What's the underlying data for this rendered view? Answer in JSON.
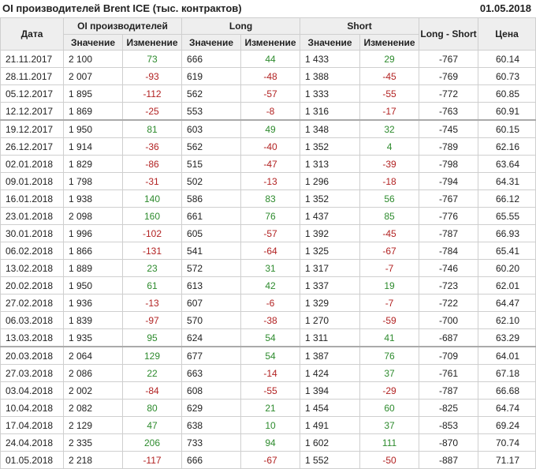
{
  "header": {
    "title": "OI производителей Brent ICE (тыс. контрактов)",
    "date": "01.05.2018"
  },
  "columns": {
    "date": "Дата",
    "oi_group": "OI производителей",
    "long_group": "Long",
    "short_group": "Short",
    "long_short": "Long - Short",
    "price": "Цена",
    "value": "Значение",
    "change": "Изменение"
  },
  "rows": [
    {
      "date": "21.11.2017",
      "oi": "2 100",
      "oi_chg": "73",
      "long": "666",
      "long_chg": "44",
      "short": "1 433",
      "short_chg": "29",
      "ls": "-767",
      "price": "60.14"
    },
    {
      "date": "28.11.2017",
      "oi": "2 007",
      "oi_chg": "-93",
      "long": "619",
      "long_chg": "-48",
      "short": "1 388",
      "short_chg": "-45",
      "ls": "-769",
      "price": "60.73"
    },
    {
      "date": "05.12.2017",
      "oi": "1 895",
      "oi_chg": "-112",
      "long": "562",
      "long_chg": "-57",
      "short": "1 333",
      "short_chg": "-55",
      "ls": "-772",
      "price": "60.85"
    },
    {
      "date": "12.12.2017",
      "oi": "1 869",
      "oi_chg": "-25",
      "long": "553",
      "long_chg": "-8",
      "short": "1 316",
      "short_chg": "-17",
      "ls": "-763",
      "price": "60.91"
    },
    {
      "date": "19.12.2017",
      "oi": "1 950",
      "oi_chg": "81",
      "long": "603",
      "long_chg": "49",
      "short": "1 348",
      "short_chg": "32",
      "ls": "-745",
      "price": "60.15"
    },
    {
      "date": "26.12.2017",
      "oi": "1 914",
      "oi_chg": "-36",
      "long": "562",
      "long_chg": "-40",
      "short": "1 352",
      "short_chg": "4",
      "ls": "-789",
      "price": "62.16"
    },
    {
      "date": "02.01.2018",
      "oi": "1 829",
      "oi_chg": "-86",
      "long": "515",
      "long_chg": "-47",
      "short": "1 313",
      "short_chg": "-39",
      "ls": "-798",
      "price": "63.64"
    },
    {
      "date": "09.01.2018",
      "oi": "1 798",
      "oi_chg": "-31",
      "long": "502",
      "long_chg": "-13",
      "short": "1 296",
      "short_chg": "-18",
      "ls": "-794",
      "price": "64.31"
    },
    {
      "date": "16.01.2018",
      "oi": "1 938",
      "oi_chg": "140",
      "long": "586",
      "long_chg": "83",
      "short": "1 352",
      "short_chg": "56",
      "ls": "-767",
      "price": "66.12"
    },
    {
      "date": "23.01.2018",
      "oi": "2 098",
      "oi_chg": "160",
      "long": "661",
      "long_chg": "76",
      "short": "1 437",
      "short_chg": "85",
      "ls": "-776",
      "price": "65.55"
    },
    {
      "date": "30.01.2018",
      "oi": "1 996",
      "oi_chg": "-102",
      "long": "605",
      "long_chg": "-57",
      "short": "1 392",
      "short_chg": "-45",
      "ls": "-787",
      "price": "66.93"
    },
    {
      "date": "06.02.2018",
      "oi": "1 866",
      "oi_chg": "-131",
      "long": "541",
      "long_chg": "-64",
      "short": "1 325",
      "short_chg": "-67",
      "ls": "-784",
      "price": "65.41"
    },
    {
      "date": "13.02.2018",
      "oi": "1 889",
      "oi_chg": "23",
      "long": "572",
      "long_chg": "31",
      "short": "1 317",
      "short_chg": "-7",
      "ls": "-746",
      "price": "60.20"
    },
    {
      "date": "20.02.2018",
      "oi": "1 950",
      "oi_chg": "61",
      "long": "613",
      "long_chg": "42",
      "short": "1 337",
      "short_chg": "19",
      "ls": "-723",
      "price": "62.01"
    },
    {
      "date": "27.02.2018",
      "oi": "1 936",
      "oi_chg": "-13",
      "long": "607",
      "long_chg": "-6",
      "short": "1 329",
      "short_chg": "-7",
      "ls": "-722",
      "price": "64.47"
    },
    {
      "date": "06.03.2018",
      "oi": "1 839",
      "oi_chg": "-97",
      "long": "570",
      "long_chg": "-38",
      "short": "1 270",
      "short_chg": "-59",
      "ls": "-700",
      "price": "62.10"
    },
    {
      "date": "13.03.2018",
      "oi": "1 935",
      "oi_chg": "95",
      "long": "624",
      "long_chg": "54",
      "short": "1 311",
      "short_chg": "41",
      "ls": "-687",
      "price": "63.29"
    },
    {
      "date": "20.03.2018",
      "oi": "2 064",
      "oi_chg": "129",
      "long": "677",
      "long_chg": "54",
      "short": "1 387",
      "short_chg": "76",
      "ls": "-709",
      "price": "64.01"
    },
    {
      "date": "27.03.2018",
      "oi": "2 086",
      "oi_chg": "22",
      "long": "663",
      "long_chg": "-14",
      "short": "1 424",
      "short_chg": "37",
      "ls": "-761",
      "price": "67.18"
    },
    {
      "date": "03.04.2018",
      "oi": "2 002",
      "oi_chg": "-84",
      "long": "608",
      "long_chg": "-55",
      "short": "1 394",
      "short_chg": "-29",
      "ls": "-787",
      "price": "66.68"
    },
    {
      "date": "10.04.2018",
      "oi": "2 082",
      "oi_chg": "80",
      "long": "629",
      "long_chg": "21",
      "short": "1 454",
      "short_chg": "60",
      "ls": "-825",
      "price": "64.74"
    },
    {
      "date": "17.04.2018",
      "oi": "2 129",
      "oi_chg": "47",
      "long": "638",
      "long_chg": "10",
      "short": "1 491",
      "short_chg": "37",
      "ls": "-853",
      "price": "69.24"
    },
    {
      "date": "24.04.2018",
      "oi": "2 335",
      "oi_chg": "206",
      "long": "733",
      "long_chg": "94",
      "short": "1 602",
      "short_chg": "111",
      "ls": "-870",
      "price": "70.74"
    },
    {
      "date": "01.05.2018",
      "oi": "2 218",
      "oi_chg": "-117",
      "long": "666",
      "long_chg": "-67",
      "short": "1 552",
      "short_chg": "-50",
      "ls": "-887",
      "price": "71.17"
    }
  ],
  "group_starts": [
    4,
    17
  ],
  "colors": {
    "positive": "#2e8b2e",
    "negative": "#b22222",
    "header_bg": "#eeeeee",
    "border": "#cfcfcf"
  }
}
